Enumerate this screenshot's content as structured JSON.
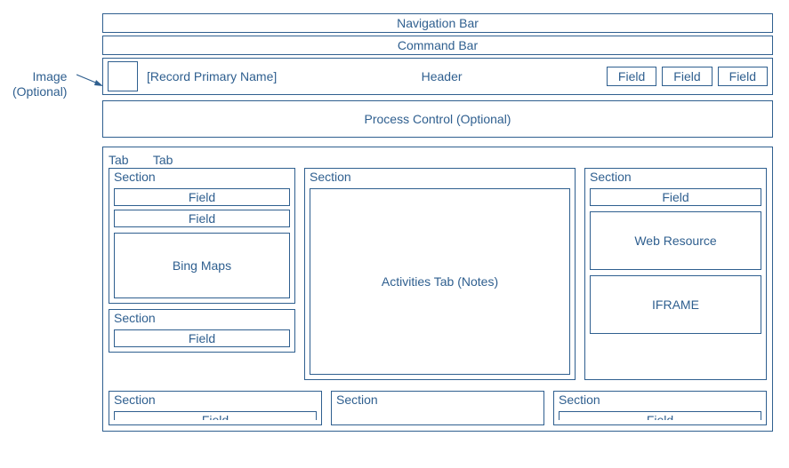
{
  "annotation": {
    "line1": "Image",
    "line2": "(Optional)"
  },
  "nav_bar": "Navigation Bar",
  "command_bar": "Command Bar",
  "header": {
    "primary_name": "[Record Primary Name]",
    "label": "Header",
    "field1": "Field",
    "field2": "Field",
    "field3": "Field"
  },
  "process": "Process Control (Optional)",
  "tabs": {
    "tab1": "Tab",
    "tab2": "Tab"
  },
  "left": {
    "section1": {
      "title": "Section",
      "field1": "Field",
      "field2": "Field",
      "maps": "Bing Maps"
    },
    "section2": {
      "title": "Section",
      "field1": "Field"
    }
  },
  "mid": {
    "title": "Section",
    "activities": "Activities Tab (Notes)"
  },
  "right": {
    "title": "Section",
    "field1": "Field",
    "web_resource": "Web Resource",
    "iframe": "IFRAME"
  },
  "bottom": {
    "s1": {
      "title": "Section",
      "field": "Field"
    },
    "s2": {
      "title": "Section"
    },
    "s3": {
      "title": "Section",
      "field": "Field"
    }
  }
}
